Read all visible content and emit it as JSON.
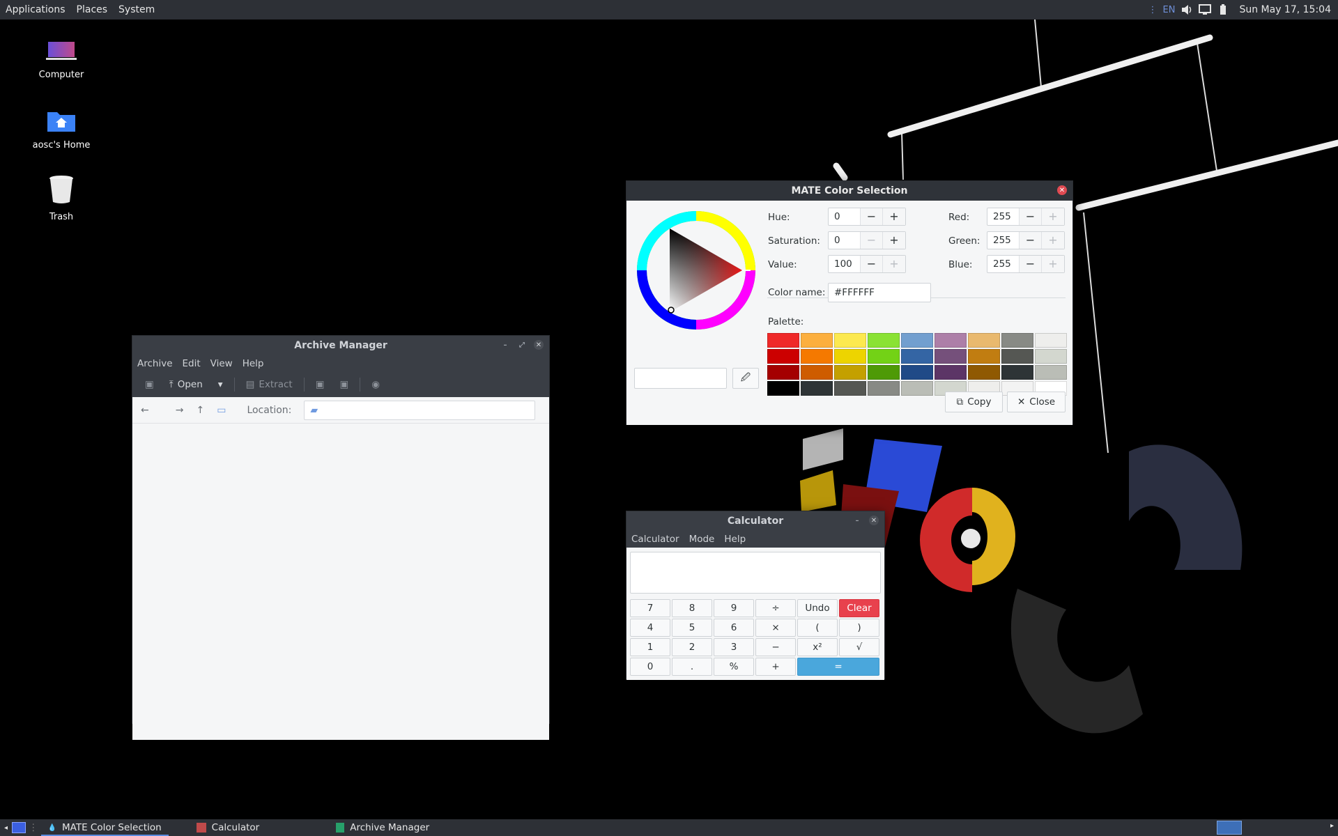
{
  "top_panel": {
    "menus": [
      "Applications",
      "Places",
      "System"
    ],
    "lang": "EN",
    "clock": "Sun May 17, 15:04"
  },
  "desktop_icons": [
    {
      "label": "Computer",
      "icon": "computer-icon"
    },
    {
      "label": "aosc's Home",
      "icon": "home-folder-icon"
    },
    {
      "label": "Trash",
      "icon": "trash-icon"
    }
  ],
  "archive_manager": {
    "title": "Archive Manager",
    "menus": [
      "Archive",
      "Edit",
      "View",
      "Help"
    ],
    "toolbar": {
      "open_label": "Open",
      "extract_label": "Extract"
    },
    "location_label": "Location:",
    "location_value": ""
  },
  "color_selection": {
    "title": "MATE Color Selection",
    "hue_label": "Hue:",
    "hue": "0",
    "saturation_label": "Saturation:",
    "saturation": "0",
    "value_label": "Value:",
    "value": "100",
    "red_label": "Red:",
    "red": "255",
    "green_label": "Green:",
    "green": "255",
    "blue_label": "Blue:",
    "blue": "255",
    "color_name_label": "Color name:",
    "color_name": "#FFFFFF",
    "palette_label": "Palette:",
    "palette": [
      [
        "#ef2929",
        "#fcaf3e",
        "#fce94f",
        "#8ae234",
        "#729fcf",
        "#ad7fa8",
        "#e9b96e",
        "#888a85",
        "#eeeeec"
      ],
      [
        "#cc0000",
        "#f57900",
        "#edd400",
        "#73d216",
        "#3465a4",
        "#75507b",
        "#c17d11",
        "#555753",
        "#d3d7cf"
      ],
      [
        "#a40000",
        "#ce5c00",
        "#c4a000",
        "#4e9a06",
        "#204a87",
        "#5c3566",
        "#8f5902",
        "#2e3436",
        "#babdb6"
      ],
      [
        "#000000",
        "#2e3436",
        "#555753",
        "#888a85",
        "#babdb6",
        "#d3d7cf",
        "#eeeeec",
        "#f3f3f3",
        "#ffffff"
      ]
    ],
    "copy_label": "Copy",
    "close_label": "Close",
    "current_color": "#FFFFFF"
  },
  "calculator": {
    "title": "Calculator",
    "menus": [
      "Calculator",
      "Mode",
      "Help"
    ],
    "display": "",
    "keys": [
      "7",
      "8",
      "9",
      "÷",
      "Undo",
      "Clear",
      "4",
      "5",
      "6",
      "×",
      "(",
      ")",
      "1",
      "2",
      "3",
      "−",
      "x²",
      "√",
      "0",
      ".",
      "%",
      "+",
      "="
    ]
  },
  "taskbar": {
    "tasks": [
      {
        "label": "MATE Color Selection",
        "active": true
      },
      {
        "label": "Calculator",
        "active": false
      },
      {
        "label": "Archive Manager",
        "active": false
      }
    ]
  }
}
